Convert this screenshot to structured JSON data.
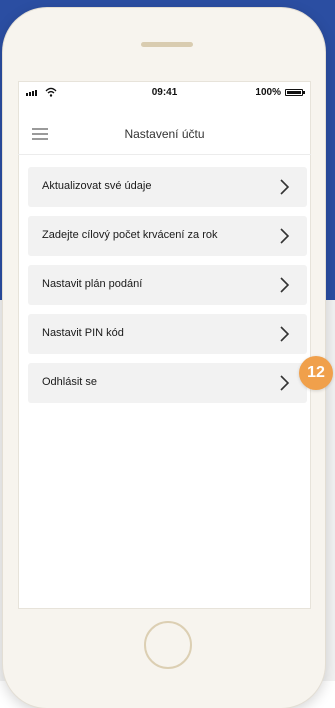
{
  "status_bar": {
    "time": "09:41",
    "battery": "100%"
  },
  "nav": {
    "title": "Nastavení účtu",
    "menu_icon": "hamburger-icon"
  },
  "menu": [
    {
      "label": "Aktualizovat své údaje",
      "icon": "chevron-right-icon"
    },
    {
      "label": "Zadejte cílový počet krvácení za rok",
      "icon": "chevron-right-icon"
    },
    {
      "label": "Nastavit plán podání",
      "icon": "chevron-right-icon"
    },
    {
      "label": "Nastavit PIN kód",
      "icon": "chevron-right-icon"
    },
    {
      "label": "Odhlásit se",
      "icon": "chevron-right-icon"
    }
  ],
  "badge": "12",
  "colors": {
    "background_blue": "#2b4ea2",
    "badge_orange": "#f0a04b",
    "item_bg": "#f2f2f2",
    "phone_frame": "#f7f4ee"
  }
}
